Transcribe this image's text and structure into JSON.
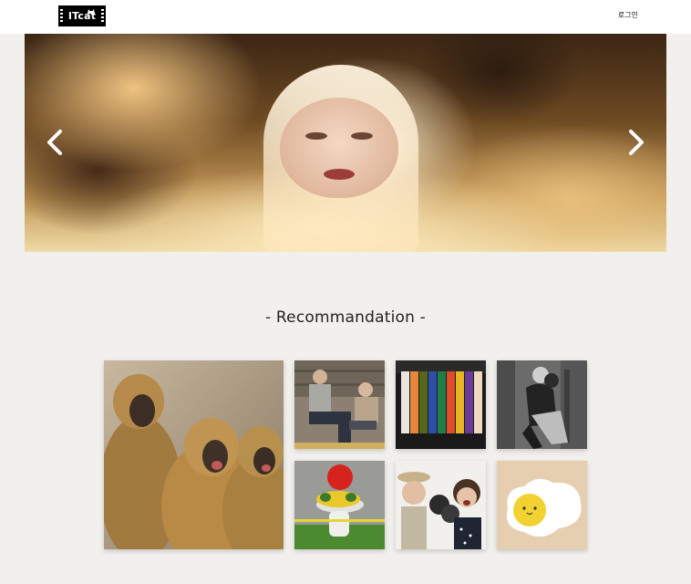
{
  "header": {
    "logo_text": "ITcat",
    "login_label": "로그인"
  },
  "carousel": {
    "prev_icon": "chevron-left-icon",
    "next_icon": "chevron-right-icon"
  },
  "recommendation": {
    "title": "- Recommandation -"
  },
  "colors": {
    "header_bg": "#ffffff",
    "page_bg": "#f2f0ec",
    "logo_bg": "#000000"
  }
}
